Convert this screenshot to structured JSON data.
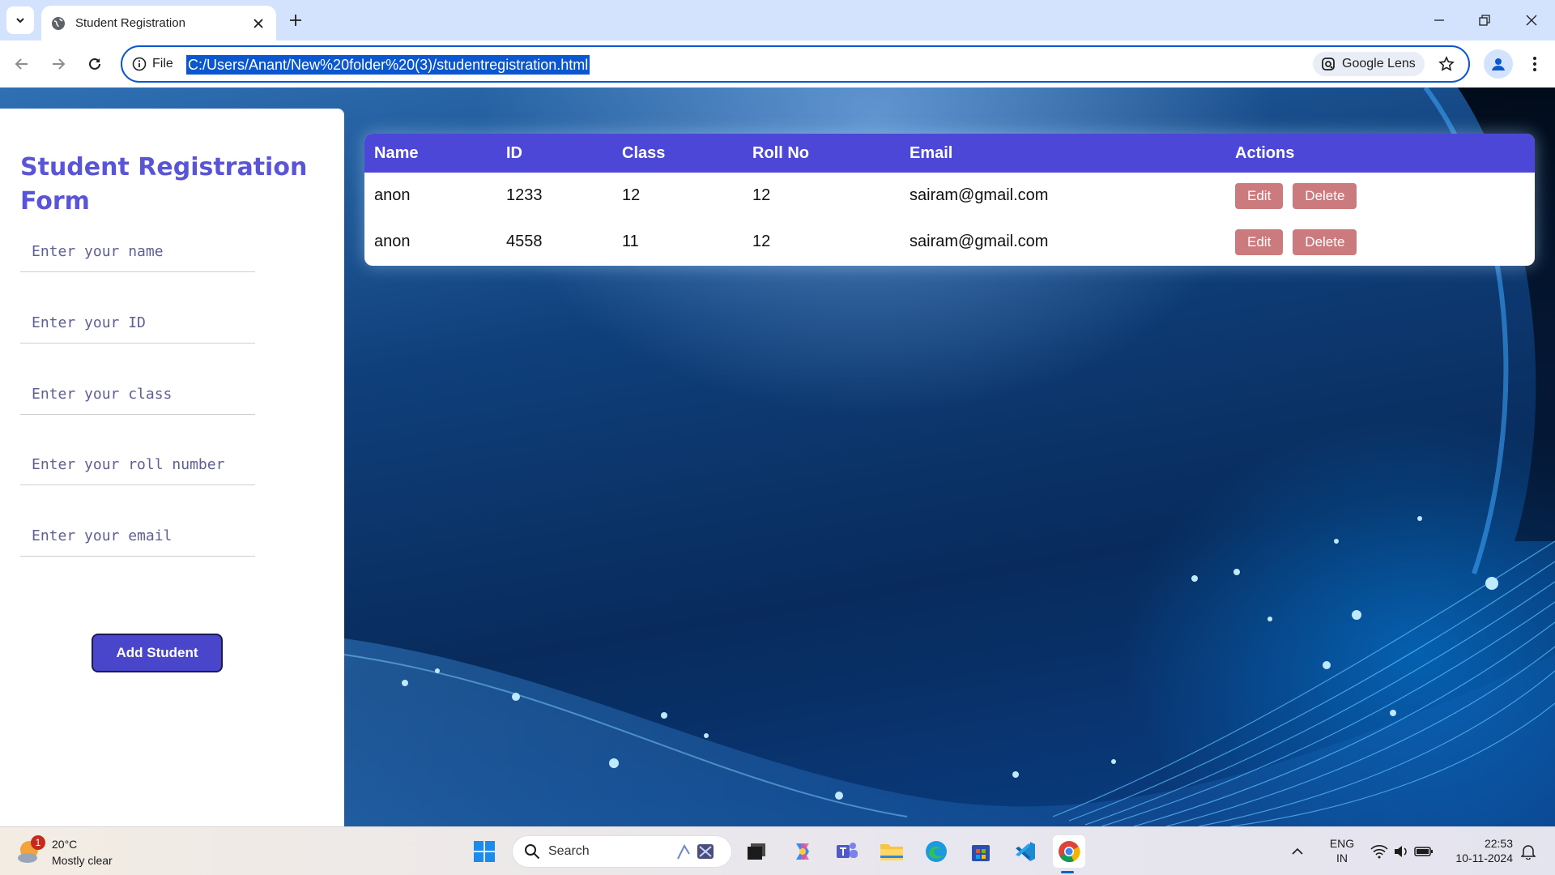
{
  "browser": {
    "tab_title": "Student Registration",
    "url": "C:/Users/Anant/New%20folder%20(3)/studentregistration.html",
    "site_label": "File",
    "lens_label": "Google Lens"
  },
  "form": {
    "title": "Student Registration Form",
    "fields": [
      {
        "name": "name",
        "placeholder": "Enter your name"
      },
      {
        "name": "id",
        "placeholder": "Enter your ID"
      },
      {
        "name": "class",
        "placeholder": "Enter your class"
      },
      {
        "name": "roll",
        "placeholder": "Enter your roll number"
      },
      {
        "name": "email",
        "placeholder": "Enter your email"
      }
    ],
    "submit_label": "Add Student"
  },
  "table": {
    "headers": [
      "Name",
      "ID",
      "Class",
      "Roll No",
      "Email",
      "Actions"
    ],
    "rows": [
      {
        "name": "anon",
        "id": "1233",
        "class": "12",
        "roll": "12",
        "email": "sairam@gmail.com"
      },
      {
        "name": "anon",
        "id": "4558",
        "class": "11",
        "roll": "12",
        "email": "sairam@gmail.com"
      }
    ],
    "edit_label": "Edit",
    "delete_label": "Delete"
  },
  "taskbar": {
    "weather_temp": "20°C",
    "weather_condition": "Mostly clear",
    "weather_badge": "1",
    "search_label": "Search",
    "lang_line1": "ENG",
    "lang_line2": "IN",
    "time": "22:53",
    "date": "10-11-2024"
  },
  "colors": {
    "accent": "#4d47d7",
    "title": "#5a55d6",
    "action_button": "#cb7b7d",
    "omnibox_border": "#0b57d0"
  }
}
